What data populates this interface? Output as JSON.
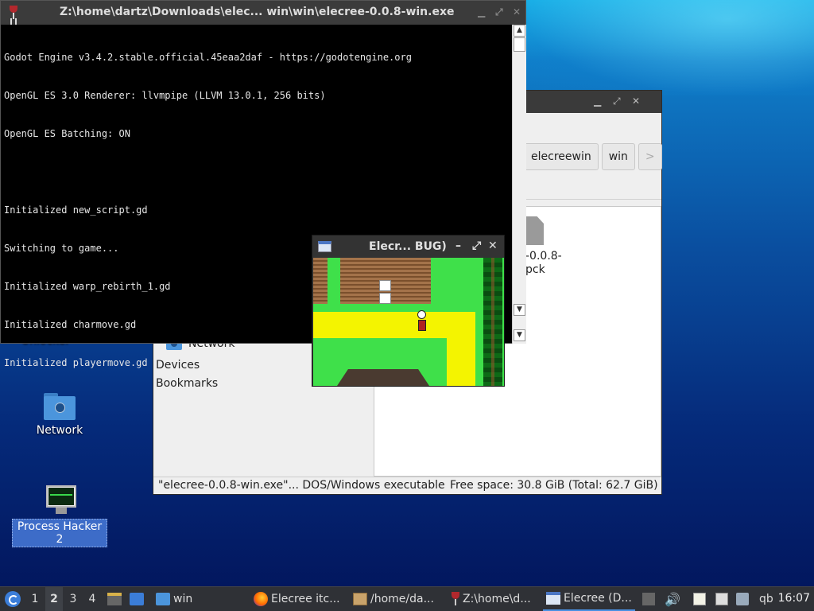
{
  "desktop": {
    "partial_icon_label": "Unlocker",
    "network_label": "Network",
    "process_hacker_label": "Process Hacker 2"
  },
  "console_window": {
    "title": "Z:\\home\\dartz\\Downloads\\elec... win\\win\\elecree-0.0.8-win.exe",
    "lines": [
      "Godot Engine v3.4.2.stable.official.45eaa2daf - https://godotengine.org",
      "OpenGL ES 3.0 Renderer: llvmpipe (LLVM 13.0.1, 256 bits)",
      "OpenGL ES Batching: ON",
      "",
      "Initialized new_script.gd",
      "Switching to game...",
      "Initialized warp_rebirth_1.gd",
      "Initialized charmove.gd",
      "Initialized playermove.gd"
    ]
  },
  "file_manager": {
    "breadcrumbs": [
      "elecreewin",
      "win",
      ">"
    ],
    "sidebar": {
      "network": "Network",
      "devices": "Devices",
      "bookmarks": "Bookmarks"
    },
    "file": {
      "name_line1": "-0.0.8-",
      "name_line2": "pck"
    },
    "status": {
      "selection": "\"elecree-0.0.8-win.exe\"... DOS/Windows executable",
      "free_space": "Free space: 30.8 GiB (Total: 62.7 GiB)"
    }
  },
  "game_window": {
    "title": "Elecr... BUG)"
  },
  "taskbar": {
    "workspaces": [
      "1",
      "2",
      "3",
      "4"
    ],
    "current_workspace": "2",
    "tasks": [
      {
        "label": "win",
        "icon": "folder-icon"
      },
      {
        "label": "Elecree itc...",
        "icon": "firefox-icon"
      },
      {
        "label": "/home/da...",
        "icon": "package-icon"
      },
      {
        "label": "Z:\\home\\d...",
        "icon": "wine-icon"
      },
      {
        "label": "Elecree (D...",
        "icon": "app-window-icon"
      }
    ],
    "tray_text": "qb",
    "clock": "16:07"
  }
}
